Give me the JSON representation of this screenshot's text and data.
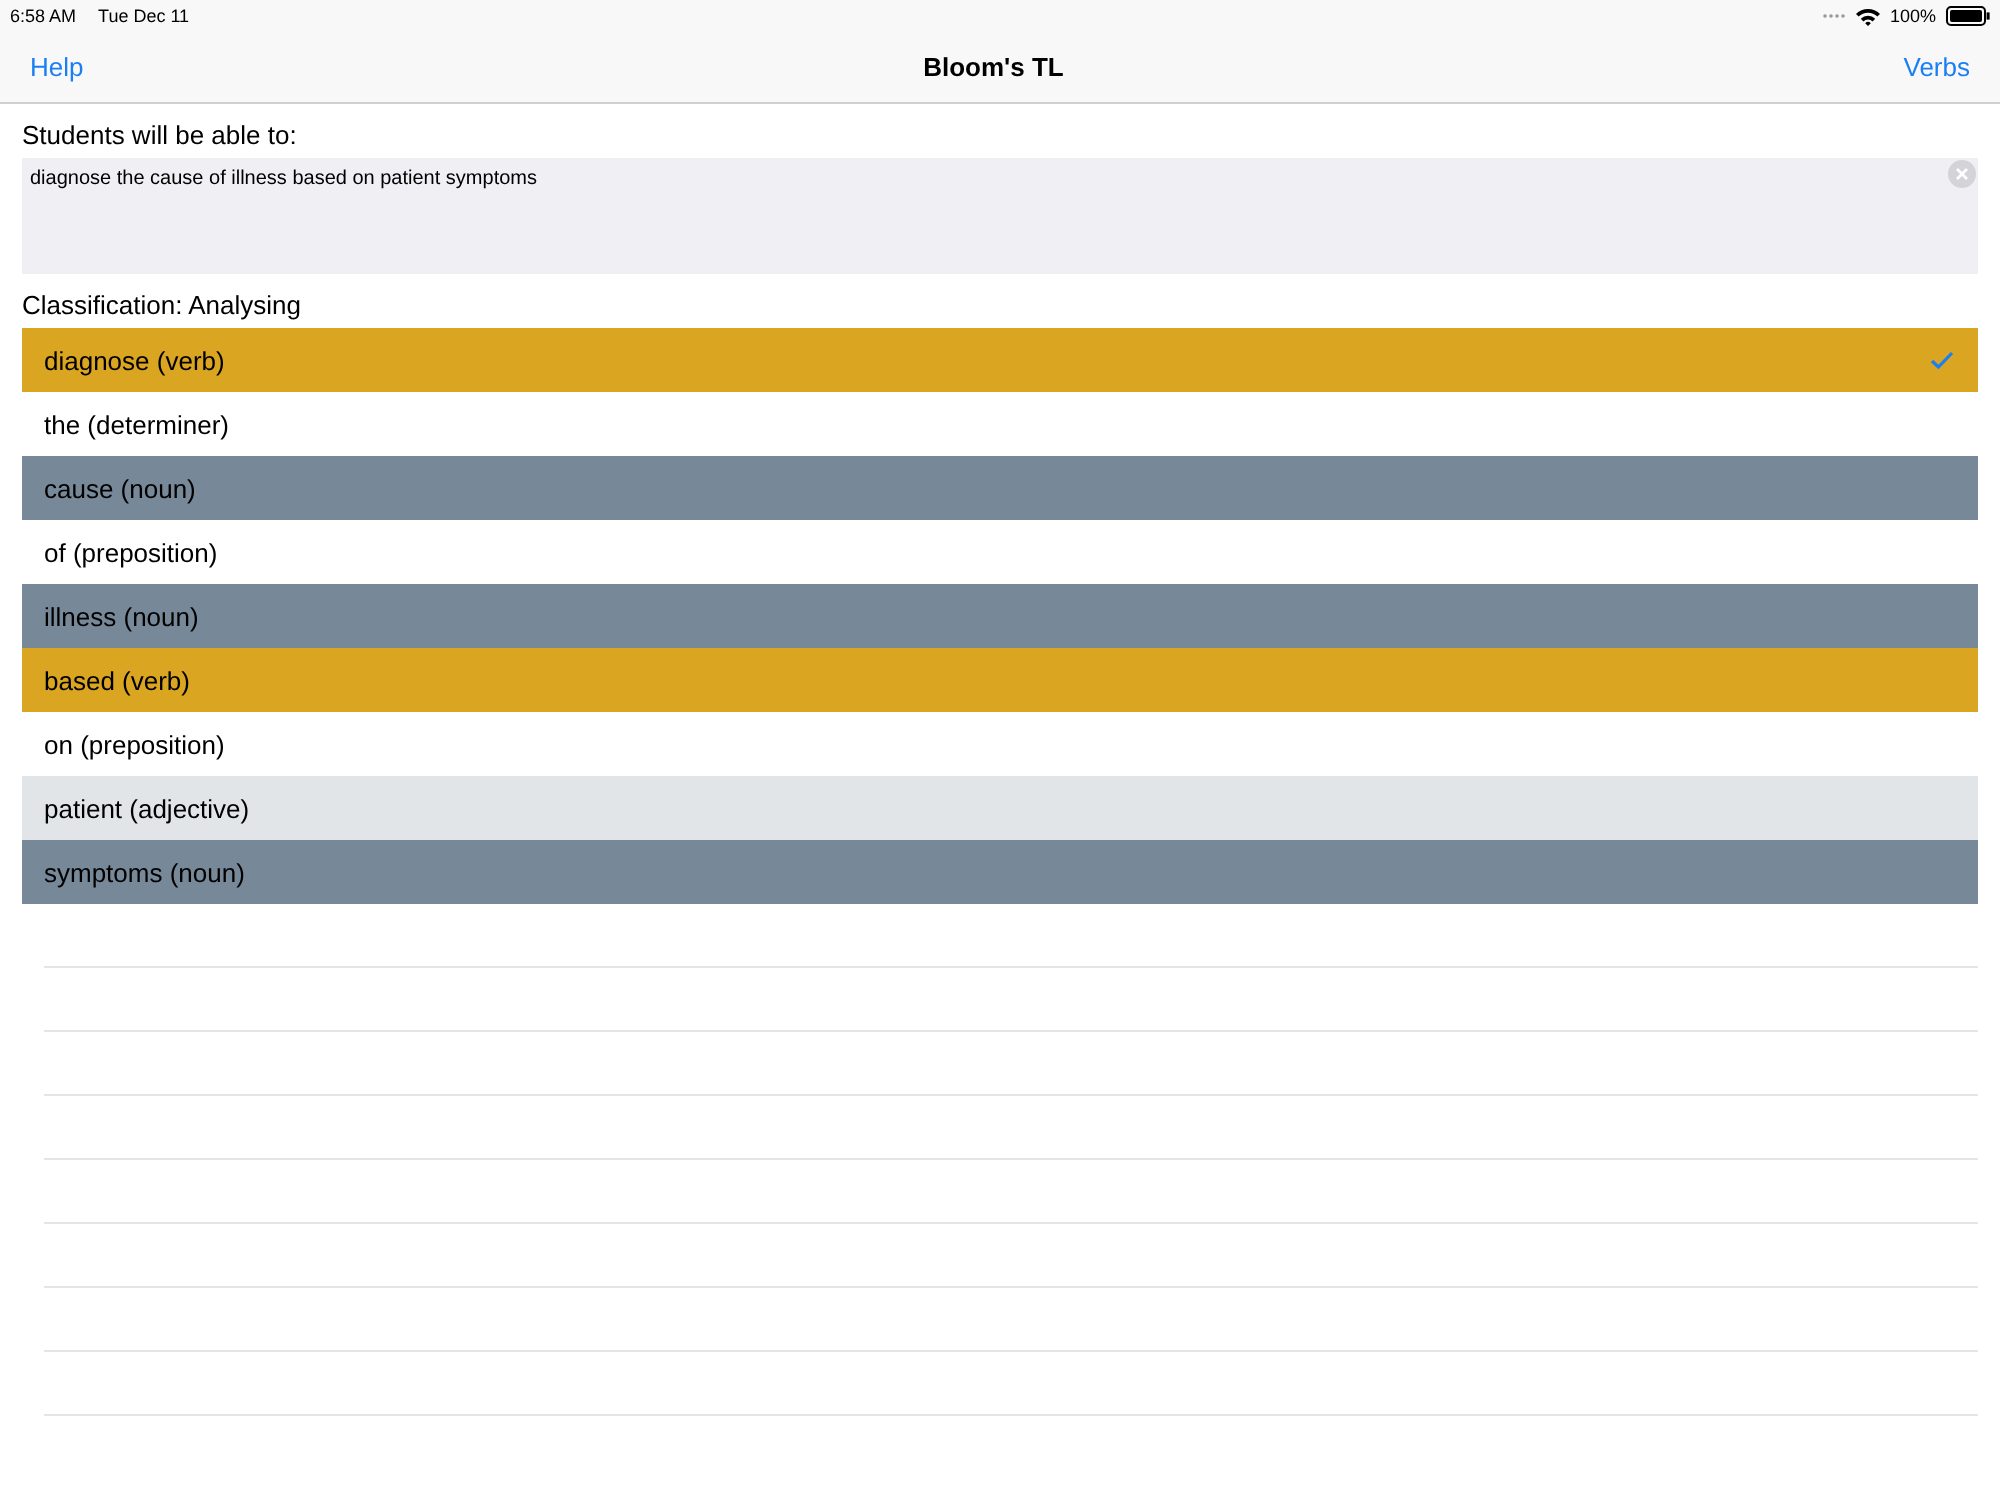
{
  "status_bar": {
    "time": "6:58 AM",
    "date": "Tue Dec 11",
    "battery": "100%"
  },
  "nav": {
    "left": "Help",
    "title": "Bloom's TL",
    "right": "Verbs"
  },
  "prompt": "Students will be able to:",
  "objective": {
    "value": "diagnose the cause of illness based on patient symptoms"
  },
  "classification": "Classification: Analysing",
  "words": [
    {
      "label": "diagnose (verb)",
      "color": "#daa520",
      "checked": true
    },
    {
      "label": "the (determiner)",
      "color": "#ffffff",
      "checked": false
    },
    {
      "label": "cause (noun)",
      "color": "#778899",
      "checked": false
    },
    {
      "label": "of (preposition)",
      "color": "#ffffff",
      "checked": false
    },
    {
      "label": "illness (noun)",
      "color": "#778899",
      "checked": false
    },
    {
      "label": "based (verb)",
      "color": "#daa520",
      "checked": false
    },
    {
      "label": "on (preposition)",
      "color": "#ffffff",
      "checked": false
    },
    {
      "label": "patient (adjective)",
      "color": "#e2e5e8",
      "checked": false
    },
    {
      "label": "symptoms (noun)",
      "color": "#778899",
      "checked": false
    }
  ]
}
